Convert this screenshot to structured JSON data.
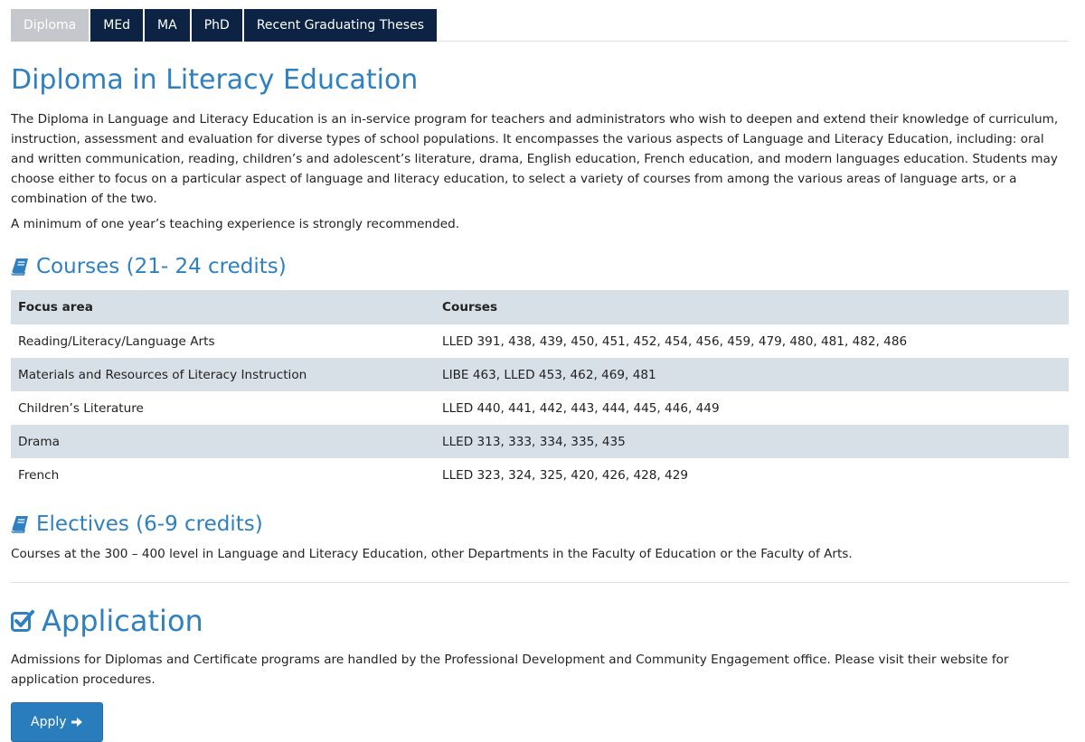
{
  "tabs": [
    {
      "label": "Diploma",
      "active": true
    },
    {
      "label": "MEd",
      "active": false
    },
    {
      "label": "MA",
      "active": false
    },
    {
      "label": "PhD",
      "active": false
    },
    {
      "label": "Recent Graduating Theses",
      "active": false
    }
  ],
  "page": {
    "title": "Diploma in Literacy Education",
    "intro": "The Diploma in Language and Literacy Education is an in-service program for teachers and administrators who wish to deepen and extend their knowledge of curriculum, instruction, assessment and evaluation for diverse types of school populations. It encompasses the various aspects of Language and Literacy Education, including: oral and written communication, reading, children’s and adolescent’s literature, drama, English education, French education, and modern languages education. Students may choose either to focus on a particular aspect of language and literacy education, to select a variety of courses from among the various areas of language arts, or a combination of the two.",
    "note": "A minimum of one year’s teaching experience is strongly recommended."
  },
  "courses": {
    "heading": "Courses (21- 24 credits)",
    "icon": "book-icon",
    "headers": [
      "Focus area",
      "Courses"
    ],
    "rows": [
      [
        "Reading/Literacy/Language Arts",
        "LLED 391, 438, 439, 450, 451, 452, 454, 456, 459, 479, 480, 481, 482, 486"
      ],
      [
        "Materials and Resources of Literacy Instruction",
        "LIBE 463, LLED 453, 462, 469, 481"
      ],
      [
        "Children’s Literature",
        "LLED 440, 441, 442, 443, 444, 445, 446, 449"
      ],
      [
        "Drama",
        "LLED 313, 333, 334, 335, 435"
      ],
      [
        "French",
        "LLED 323, 324, 325, 420, 426, 428, 429"
      ]
    ]
  },
  "electives": {
    "heading": "Electives (6-9 credits)",
    "icon": "book-icon",
    "text": "Courses at the 300 – 400 level in Language and Literacy Education, other Departments in the Faculty of Education or the Faculty of Arts."
  },
  "application": {
    "heading": "Application",
    "icon": "check-square-icon",
    "text": "Admissions for Diplomas and Certificate programs are handled by the Professional Development and Community Engagement office. Please visit their website for application procedures.",
    "button_label": "Apply",
    "button_icon": "arrow-right-icon"
  },
  "colors": {
    "accent": "#2f80c0",
    "tab_bg": "#0c2344",
    "tab_active_bg": "#c4c8cc",
    "table_stripe": "#d7dfe7",
    "button_bg": "#2a7dbd"
  }
}
